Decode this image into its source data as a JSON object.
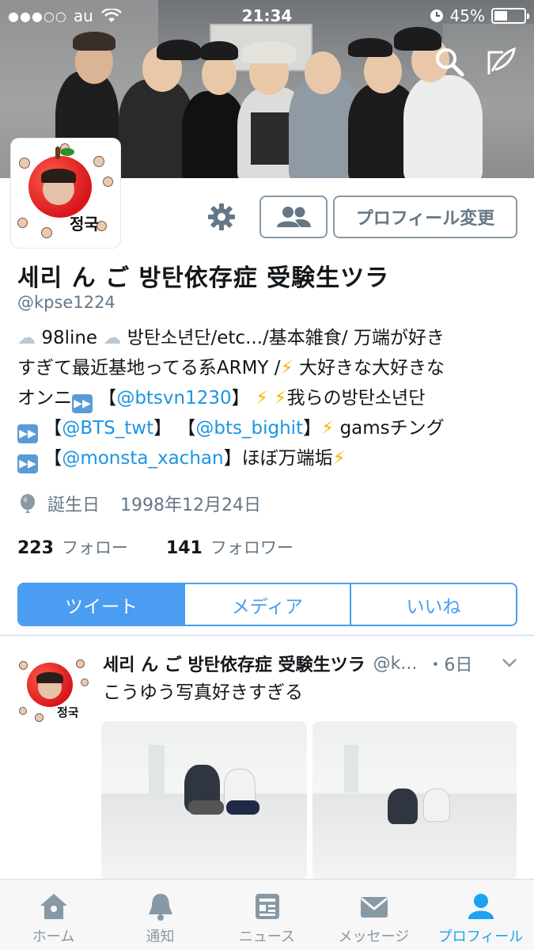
{
  "status_bar": {
    "signal": "●●●○○",
    "carrier": "au",
    "time": "21:34",
    "battery_percent": "45%",
    "battery_level": 0.45
  },
  "profile": {
    "avatar_text": "정국",
    "name": "세리 ん ご 방탄依存症 受験生ツラ",
    "handle": "@kpse1224",
    "edit_button": "プロフィール変更",
    "bio": {
      "line1_a": "98line",
      "line1_b": "방탄소년단/etc.../基本雑食/ 万端が好き",
      "line2_a": "すぎて最近基地ってる系ARMY /",
      "line2_b": "大好きな大好きな",
      "line3_a": "オンニ",
      "line3_link": "@btsvn1230",
      "line3_b": "我らの방탄소년단",
      "line4_link1": "@BTS_twt",
      "line4_link2": "@bts_bighit",
      "line4_b": "gamsチング",
      "line5_link": "@monsta_xachan",
      "line5_b": "ほぼ万端垢"
    },
    "birthday_label": "誕生日",
    "birthday_value": "1998年12月24日",
    "following_count": "223",
    "following_label": "フォロー",
    "followers_count": "141",
    "followers_label": "フォロワー"
  },
  "tabs": [
    {
      "label": "ツイート",
      "active": true
    },
    {
      "label": "メディア",
      "active": false
    },
    {
      "label": "いいね",
      "active": false
    }
  ],
  "tweet": {
    "name": "세리 ん ご 방탄依存症 受験生ツラ",
    "handle": "@k...",
    "time": "・6日",
    "text": "こうゆう写真好きすぎる"
  },
  "tabbar": [
    {
      "label": "ホーム",
      "icon": "home-icon"
    },
    {
      "label": "通知",
      "icon": "bell-icon"
    },
    {
      "label": "ニュース",
      "icon": "news-icon"
    },
    {
      "label": "メッセージ",
      "icon": "envelope-icon"
    },
    {
      "label": "プロフィール",
      "icon": "person-icon",
      "active": true
    }
  ],
  "colors": {
    "accent": "#1da1f2",
    "tab_blue": "#4a9df0",
    "link": "#1b95e0",
    "muted": "#657786"
  }
}
